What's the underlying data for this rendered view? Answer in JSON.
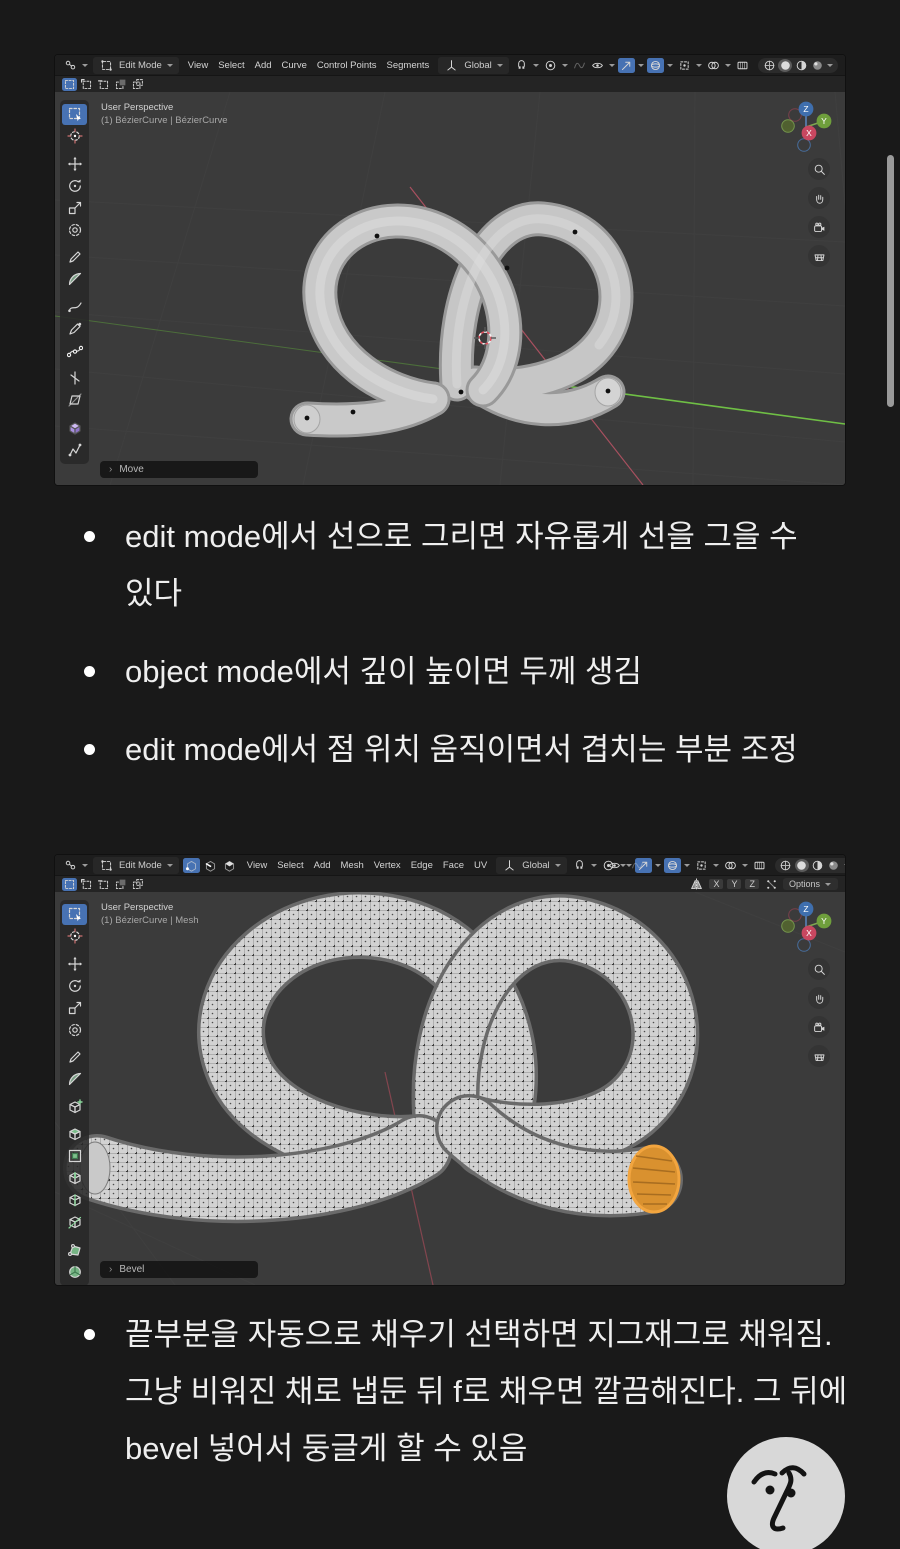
{
  "colors": {
    "accent_blue": "#4772b3",
    "selection_orange": "#d9912f",
    "axis_x_red": "#c84760",
    "axis_y_green": "#6f9f3c",
    "axis_z_blue": "#3f6fae",
    "viewport_gray": "#3b3b3b"
  },
  "gizmo": {
    "x": "X",
    "y": "Y",
    "z": "Z"
  },
  "viewport_nav": [
    {
      "name": "zoom-icon",
      "glyph": "zoom"
    },
    {
      "name": "pan-hand-icon",
      "glyph": "hand"
    },
    {
      "name": "camera-view-icon",
      "glyph": "camera"
    },
    {
      "name": "toggle-ortho-icon",
      "glyph": "ortho"
    }
  ],
  "screenshot1": {
    "header": {
      "editor_icons": [
        {
          "name": "editor-type-icon",
          "glyph": "editor",
          "caret": true
        }
      ],
      "mode_icons": [
        {
          "name": "edit-mode-icon",
          "glyph": "modebox"
        }
      ],
      "mode_label": "Edit Mode",
      "menus": [
        "View",
        "Select",
        "Add",
        "Curve",
        "Control Points",
        "Segments"
      ],
      "orientation_icons": [
        {
          "name": "orientation-icon",
          "glyph": "orient"
        }
      ],
      "orientation_label": "Global",
      "snap_icons": [
        {
          "name": "snap-magnet-icon",
          "glyph": "magnet",
          "caret": true
        },
        {
          "name": "proportional-editing-icon",
          "glyph": "prop",
          "caret": true
        },
        {
          "name": "falloff-curve-icon",
          "glyph": "falloff",
          "dim": true
        }
      ],
      "right_icons": [
        {
          "name": "show-visibility-icon",
          "glyph": "eye",
          "caret": true
        },
        {
          "name": "select-through-icon",
          "glyph": "arrow",
          "active": true,
          "caret": true
        },
        {
          "name": "proportional-sphere-icon",
          "glyph": "sphere",
          "active": true,
          "caret": true
        },
        {
          "name": "gizmos-icon",
          "glyph": "gizmo",
          "caret": true
        },
        {
          "name": "overlays-icon",
          "glyph": "overlay",
          "caret": true
        },
        {
          "name": "toggle-xray-icon",
          "glyph": "xraybox"
        }
      ],
      "shading_icons": [
        {
          "name": "wireframe-shading-icon",
          "glyph": "wire"
        },
        {
          "name": "solid-shading-icon",
          "glyph": "solid",
          "active": true
        },
        {
          "name": "material-preview-icon",
          "glyph": "material"
        },
        {
          "name": "rendered-shading-icon",
          "glyph": "render"
        }
      ]
    },
    "toolrow": {
      "select_mode_icons": [
        {
          "name": "select-set-icon",
          "glyph": "dashedsq",
          "active": true
        },
        {
          "name": "select-extend-icon",
          "glyph": "sqextend"
        },
        {
          "name": "select-subtract-icon",
          "glyph": "sqsub"
        },
        {
          "name": "select-difference-icon",
          "glyph": "sqdiff"
        },
        {
          "name": "select-intersect-icon",
          "glyph": "sqint"
        }
      ]
    },
    "toolbar": [
      {
        "name": "select-box-tool",
        "glyph": "boxselect",
        "active": true
      },
      {
        "name": "cursor-tool",
        "glyph": "cursor3d"
      },
      {
        "name": "move-tool",
        "glyph": "move",
        "gap": true
      },
      {
        "name": "rotate-tool",
        "glyph": "rotate"
      },
      {
        "name": "scale-tool",
        "glyph": "scale"
      },
      {
        "name": "transform-tool",
        "glyph": "transform"
      },
      {
        "name": "annotate-tool",
        "glyph": "annotate",
        "gap": true
      },
      {
        "name": "measure-tool",
        "glyph": "measure"
      },
      {
        "name": "draw-curve-tool",
        "glyph": "draw",
        "gap": true
      },
      {
        "name": "curve-pen-tool",
        "glyph": "pen"
      },
      {
        "name": "curve-points-tool",
        "glyph": "points"
      },
      {
        "name": "tilt-tool",
        "glyph": "tilt",
        "gap": true
      },
      {
        "name": "shear-tool",
        "glyph": "shear"
      },
      {
        "name": "extrude-tool",
        "glyph": "extrude",
        "gap": true
      },
      {
        "name": "randomize-tool",
        "glyph": "randomize"
      }
    ],
    "viewport": {
      "view_label": "User Perspective",
      "object_label": "(1) BézierCurve | BézierCurve",
      "operator_label": "Move"
    }
  },
  "screenshot2": {
    "header": {
      "editor_icons": [
        {
          "name": "editor-type-icon",
          "glyph": "editor",
          "caret": true
        }
      ],
      "mode_icons": [
        {
          "name": "edit-mode-icon",
          "glyph": "modebox"
        }
      ],
      "mode_label": "Edit Mode",
      "select_header_icons": [
        {
          "name": "vertex-select-mode-icon",
          "glyph": "vertexm",
          "active": true
        },
        {
          "name": "edge-select-mode-icon",
          "glyph": "edgem"
        },
        {
          "name": "face-select-mode-icon",
          "glyph": "facem"
        }
      ],
      "menus": [
        "View",
        "Select",
        "Add",
        "Mesh",
        "Vertex",
        "Edge",
        "Face",
        "UV"
      ],
      "orientation_icons": [
        {
          "name": "orientation-icon",
          "glyph": "orient"
        }
      ],
      "orientation_label": "Global",
      "snap_icons": [
        {
          "name": "snap-magnet-icon",
          "glyph": "magnet",
          "caret": true
        },
        {
          "name": "proportional-editing-icon",
          "glyph": "prop",
          "caret": true
        },
        {
          "name": "falloff-curve-icon",
          "glyph": "falloff",
          "dim": true
        }
      ],
      "right_icons": [
        {
          "name": "show-visibility-icon",
          "glyph": "eye",
          "caret": true
        },
        {
          "name": "select-through-icon",
          "glyph": "arrow",
          "active": true,
          "caret": true
        },
        {
          "name": "proportional-sphere-icon",
          "glyph": "sphere",
          "active": true,
          "caret": true
        },
        {
          "name": "gizmos-icon",
          "glyph": "gizmo",
          "caret": true
        },
        {
          "name": "overlays-icon",
          "glyph": "overlay",
          "caret": true
        },
        {
          "name": "toggle-xray-icon",
          "glyph": "xraybox"
        }
      ],
      "shading_icons": [
        {
          "name": "wireframe-shading-icon",
          "glyph": "wire"
        },
        {
          "name": "solid-shading-icon",
          "glyph": "solid",
          "active": true
        },
        {
          "name": "material-preview-icon",
          "glyph": "material"
        },
        {
          "name": "rendered-shading-icon",
          "glyph": "render"
        }
      ]
    },
    "toolrow": {
      "select_mode_icons": [
        {
          "name": "select-set-icon",
          "glyph": "dashedsq",
          "active": true
        },
        {
          "name": "select-extend-icon",
          "glyph": "sqextend"
        },
        {
          "name": "select-subtract-icon",
          "glyph": "sqsub"
        },
        {
          "name": "select-difference-icon",
          "glyph": "sqdiff"
        },
        {
          "name": "select-intersect-icon",
          "glyph": "sqint"
        }
      ],
      "mirror_icons": [
        {
          "name": "mirror-icon",
          "glyph": "mirror"
        }
      ],
      "mirror_axes": [
        "X",
        "Y",
        "Z"
      ],
      "snap_icons": [
        {
          "name": "snap-elements-icon",
          "glyph": "snapdots"
        }
      ],
      "options_label": "Options"
    },
    "toolbar": [
      {
        "name": "select-box-tool",
        "glyph": "boxselect",
        "active": true
      },
      {
        "name": "cursor-tool",
        "glyph": "cursor3d"
      },
      {
        "name": "move-tool",
        "glyph": "move",
        "gap": true
      },
      {
        "name": "rotate-tool",
        "glyph": "rotate"
      },
      {
        "name": "scale-tool",
        "glyph": "scale"
      },
      {
        "name": "transform-tool",
        "glyph": "transform"
      },
      {
        "name": "annotate-tool",
        "glyph": "annotate",
        "gap": true
      },
      {
        "name": "measure-tool",
        "glyph": "measure"
      },
      {
        "name": "add-cube-tool",
        "glyph": "cubeadd",
        "gap": true
      },
      {
        "name": "extrude-region-tool",
        "glyph": "extruderegion",
        "gap": true
      },
      {
        "name": "inset-faces-tool",
        "glyph": "inset"
      },
      {
        "name": "bevel-tool",
        "glyph": "bevel"
      },
      {
        "name": "loop-cut-tool",
        "glyph": "loopcut"
      },
      {
        "name": "knife-tool",
        "glyph": "knife"
      },
      {
        "name": "poly-build-tool",
        "glyph": "polybuild",
        "gap": true
      },
      {
        "name": "spin-tool",
        "glyph": "spin"
      }
    ],
    "viewport": {
      "view_label": "User Perspective",
      "object_label": "(1) BézierCurve | Mesh",
      "operator_label": "Bevel"
    }
  },
  "notes": {
    "top_bullets": [
      "edit mode에서 선으로 그리면 자유롭게 선을 그을 수 있다",
      "object mode에서 깊이 높이면 두께 생김",
      "edit mode에서 점 위치 움직이면서 겹치는 부분 조정"
    ],
    "bottom_bullets": [
      "끝부분을 자동으로 채우기 선택하면 지그재그로 채워짐. 그냥 비워진 채로 냅둔 뒤 f로 채우면 깔끔해진다. 그 뒤에 bevel 넣어서 둥글게 할 수 있음"
    ]
  },
  "avatar": {
    "name": "profile-face-logo"
  }
}
